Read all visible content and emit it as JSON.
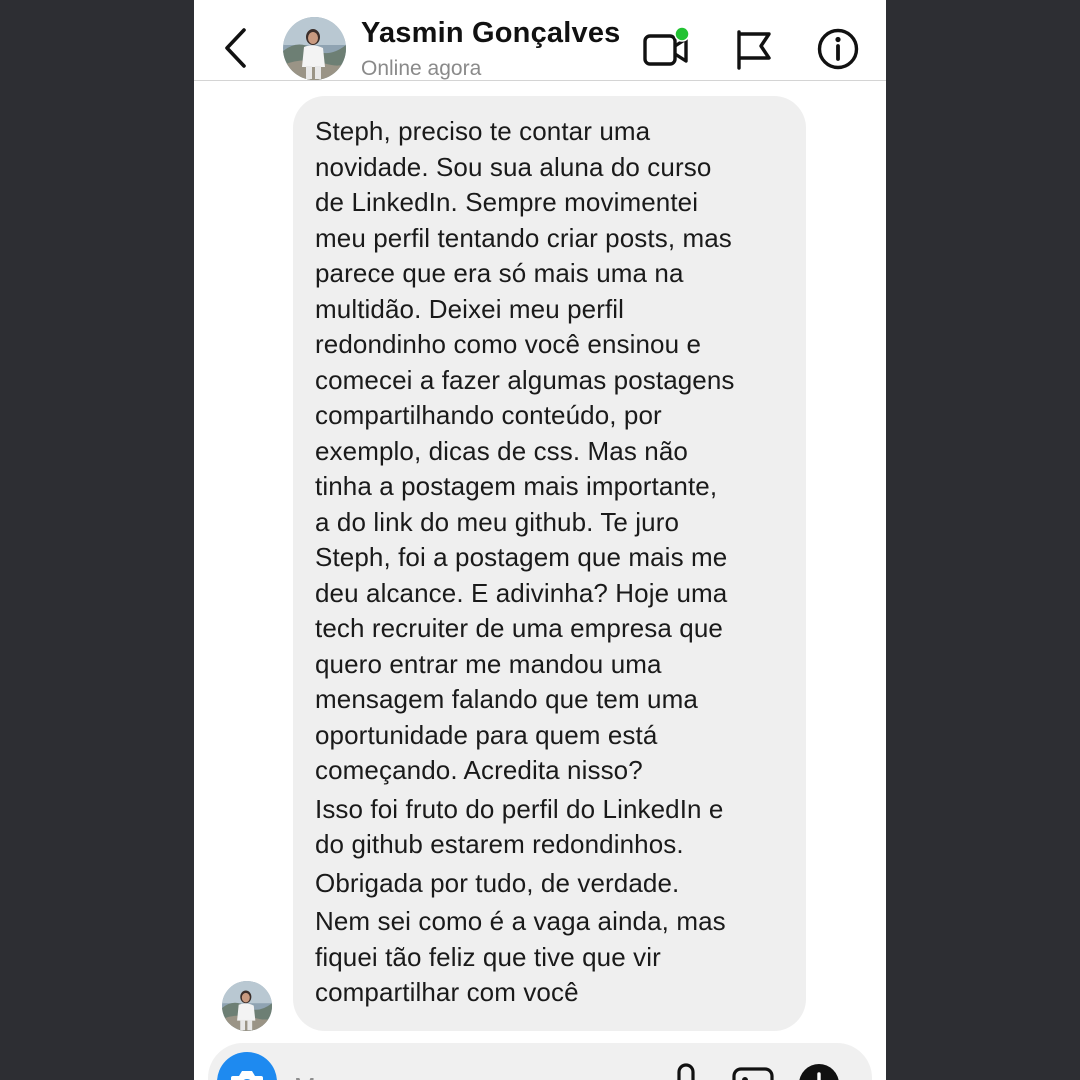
{
  "header": {
    "contact_name": "Yasmin Gonçalves",
    "status": "Online agora",
    "icons": {
      "back": "chevron-left-icon",
      "video": "video-call-icon",
      "flag": "flag-icon",
      "info": "info-icon"
    },
    "online_indicator_color": "#22c232"
  },
  "message": {
    "paragraphs": [
      "Steph, preciso te contar uma\nnovidade. Sou sua aluna do curso\nde LinkedIn. Sempre movimentei\nmeu perfil tentando criar posts, mas\nparece que era só mais uma na\nmultidão. Deixei meu perfil\nredondinho como você ensinou e\ncomecei a fazer algumas postagens\ncompartilhando conteúdo, por\nexemplo, dicas de css. Mas não\ntinha a postagem mais importante,\na do link do meu github. Te juro\nSteph, foi a postagem que mais me\ndeu alcance. E adivinha? Hoje uma\ntech recruiter de uma empresa que\nquero entrar me mandou uma\nmensagem falando que tem uma\noportunidade para quem está\ncomeçando. Acredita nisso?",
      "Isso foi fruto do perfil do LinkedIn e\ndo github estarem redondinhos.",
      "Obrigada por tudo, de verdade.",
      "Nem sei como é a vaga ainda, mas\nfiquei tão feliz que tive que vir\ncompartilhar com você"
    ]
  },
  "composer": {
    "placeholder": "Mensagem",
    "value": "",
    "icons": {
      "camera": "camera-icon",
      "mic": "microphone-icon",
      "gallery": "gallery-icon",
      "sticker": "sticker-icon"
    },
    "camera_color": "#1e8af0"
  },
  "colors": {
    "page_background": "#2d2e33",
    "bubble_background": "#efefef",
    "text": "#1a1a1a",
    "muted_text": "#8a8a8a"
  }
}
